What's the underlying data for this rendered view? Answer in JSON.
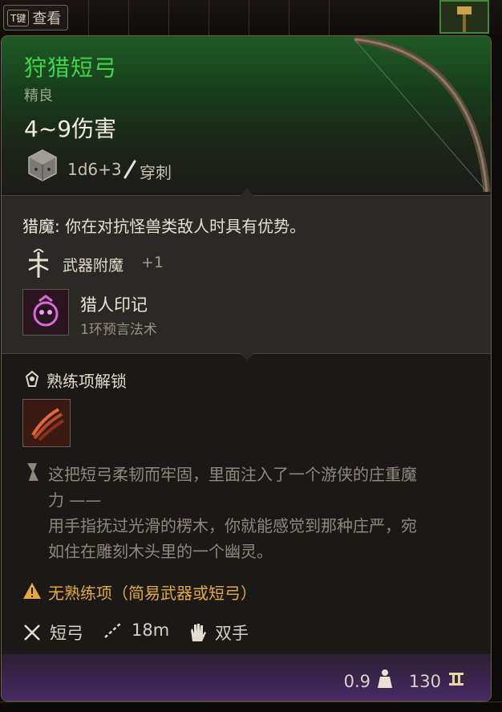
{
  "topbar": {
    "key": "T键",
    "label": "查看"
  },
  "item": {
    "name": "狩猎短弓",
    "rarity": "精良",
    "damage": "4~9伤害",
    "damage_formula": "1d6+3",
    "damage_type": "穿刺",
    "name_color": "#3fd64a"
  },
  "passive": {
    "name": "猎魔:",
    "text": " 你在对抗怪兽类敌人时具有优势。"
  },
  "enchant": {
    "label": "武器附魔",
    "value": "+1"
  },
  "spell": {
    "name": "猎人印记",
    "level": "1环预言法术"
  },
  "proficiency": {
    "title": "熟练项解锁"
  },
  "flavor": {
    "line1": "这把短弓柔韧而牢固，里面注入了一个游侠的庄重魔",
    "line2": "力 ——",
    "line3": "用手指抚过光滑的楞木，你就能感觉到那种庄严，宛",
    "line4": "如住在雕刻木头里的一个幽灵。"
  },
  "warning": {
    "text": "无熟练项（简易武器或短弓）",
    "color": "#e5a93a"
  },
  "properties": {
    "type": "短弓",
    "range": "18m",
    "handedness": "双手"
  },
  "footer": {
    "weight": "0.9",
    "value": "130"
  },
  "icons": [
    "dice-icon",
    "pierce-icon",
    "enchant-icon",
    "hunters-mark-icon",
    "proficiency-icon",
    "action-icon",
    "flavor-icon",
    "warning-icon",
    "shortbow-icon",
    "range-icon",
    "hand-icon",
    "weight-icon",
    "gold-icon",
    "bow-icon"
  ]
}
